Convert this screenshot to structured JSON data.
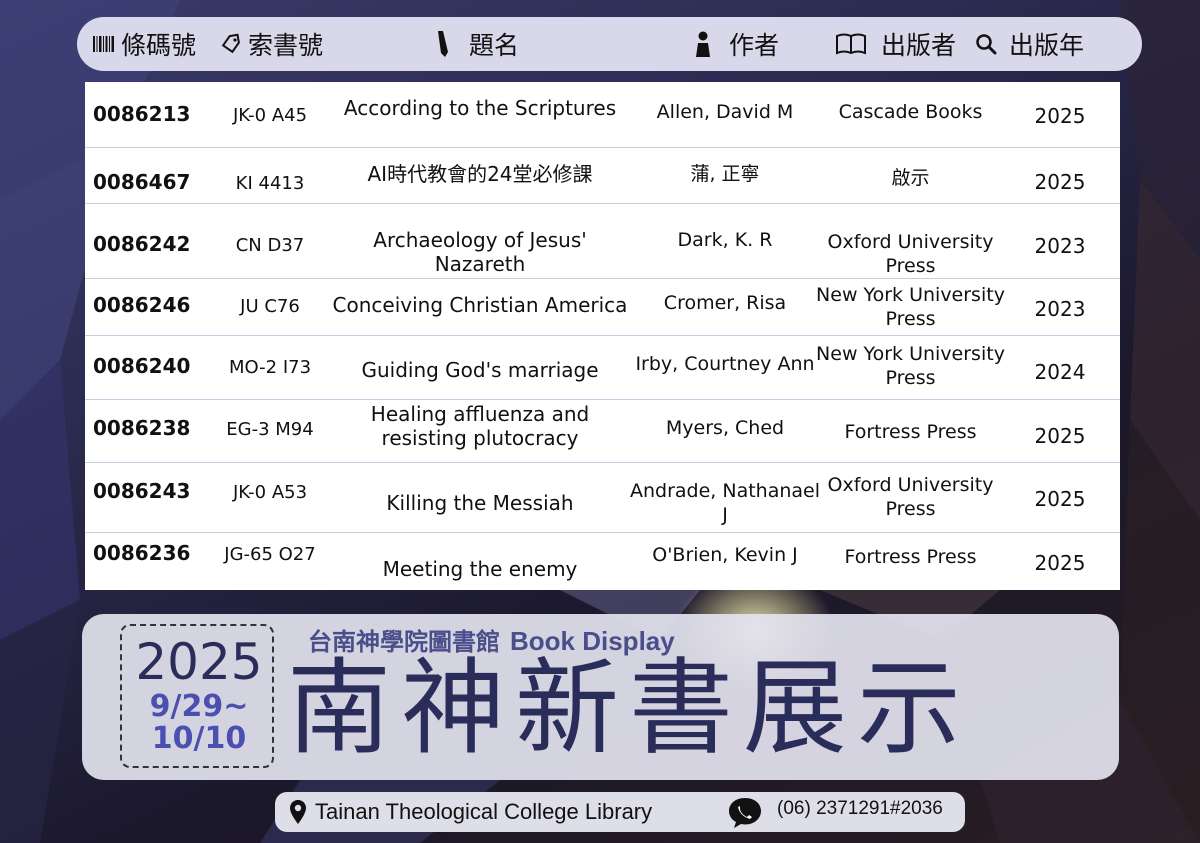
{
  "header": {
    "barcode": "條碼號",
    "call_no": "索書號",
    "title": "題名",
    "author": "作者",
    "publisher": "出版者",
    "year": "出版年"
  },
  "books": [
    {
      "barcode": "0086213",
      "call_no": "JK-0 A45",
      "title": [
        "According to the Scriptures"
      ],
      "author": "Allen, David M",
      "publisher": [
        "Cascade Books"
      ],
      "year": "2025"
    },
    {
      "barcode": "0086467",
      "call_no": "KI 4413",
      "title": [
        "AI時代教會的24堂必修課"
      ],
      "author": "蒲, 正寧",
      "publisher": [
        "啟示"
      ],
      "year": "2025"
    },
    {
      "barcode": "0086242",
      "call_no": "CN D37",
      "title": [
        "Archaeology of Jesus' Nazareth"
      ],
      "author": "Dark, K. R",
      "publisher": [
        "Oxford University Press"
      ],
      "year": "2023"
    },
    {
      "barcode": "0086246",
      "call_no": "JU C76",
      "title": [
        "Conceiving Christian America"
      ],
      "author": "Cromer, Risa",
      "publisher": [
        "New York University",
        "Press"
      ],
      "year": "2023"
    },
    {
      "barcode": "0086240",
      "call_no": "MO-2 I73",
      "title": [
        "Guiding God's marriage"
      ],
      "author": "Irby, Courtney Ann",
      "publisher": [
        "New York University",
        "Press"
      ],
      "year": "2024"
    },
    {
      "barcode": "0086238",
      "call_no": "EG-3 M94",
      "title": [
        "Healing affluenza and",
        "resisting plutocracy"
      ],
      "author": "Myers, Ched",
      "publisher": [
        "Fortress Press"
      ],
      "year": "2025"
    },
    {
      "barcode": "0086243",
      "call_no": "JK-0 A53",
      "title": [
        "Killing the Messiah"
      ],
      "author": "Andrade, Nathanael J",
      "publisher": [
        "Oxford University",
        "Press"
      ],
      "year": "2025"
    },
    {
      "barcode": "0086236",
      "call_no": "JG-65 O27",
      "title": [
        "Meeting the enemy"
      ],
      "author": "O'Brien, Kevin J",
      "publisher": [
        "Fortress Press"
      ],
      "year": "2025"
    }
  ],
  "banner": {
    "year": "2025",
    "date_start": "9/29~",
    "date_end": "10/10",
    "subtitle_zh": "台南神學院圖書館",
    "subtitle_en": "Book Display",
    "main_title": "南神新書展示"
  },
  "footer": {
    "library": "Tainan Theological College Library",
    "phone": "(06) 2371291#2036"
  },
  "icons": {
    "barcode": "barcode-icon",
    "call_no": "tag-icon",
    "title": "pen-icon",
    "author": "person-icon",
    "publisher": "open-book-icon",
    "year": "magnifier-icon",
    "location": "location-pin-icon",
    "phone": "chat-phone-icon"
  },
  "colors": {
    "header_bg": "#d8d8ea",
    "banner_text": "#2a2d5a",
    "date_accent": "#4a4fb0",
    "subtitle": "#4a4e8a"
  }
}
